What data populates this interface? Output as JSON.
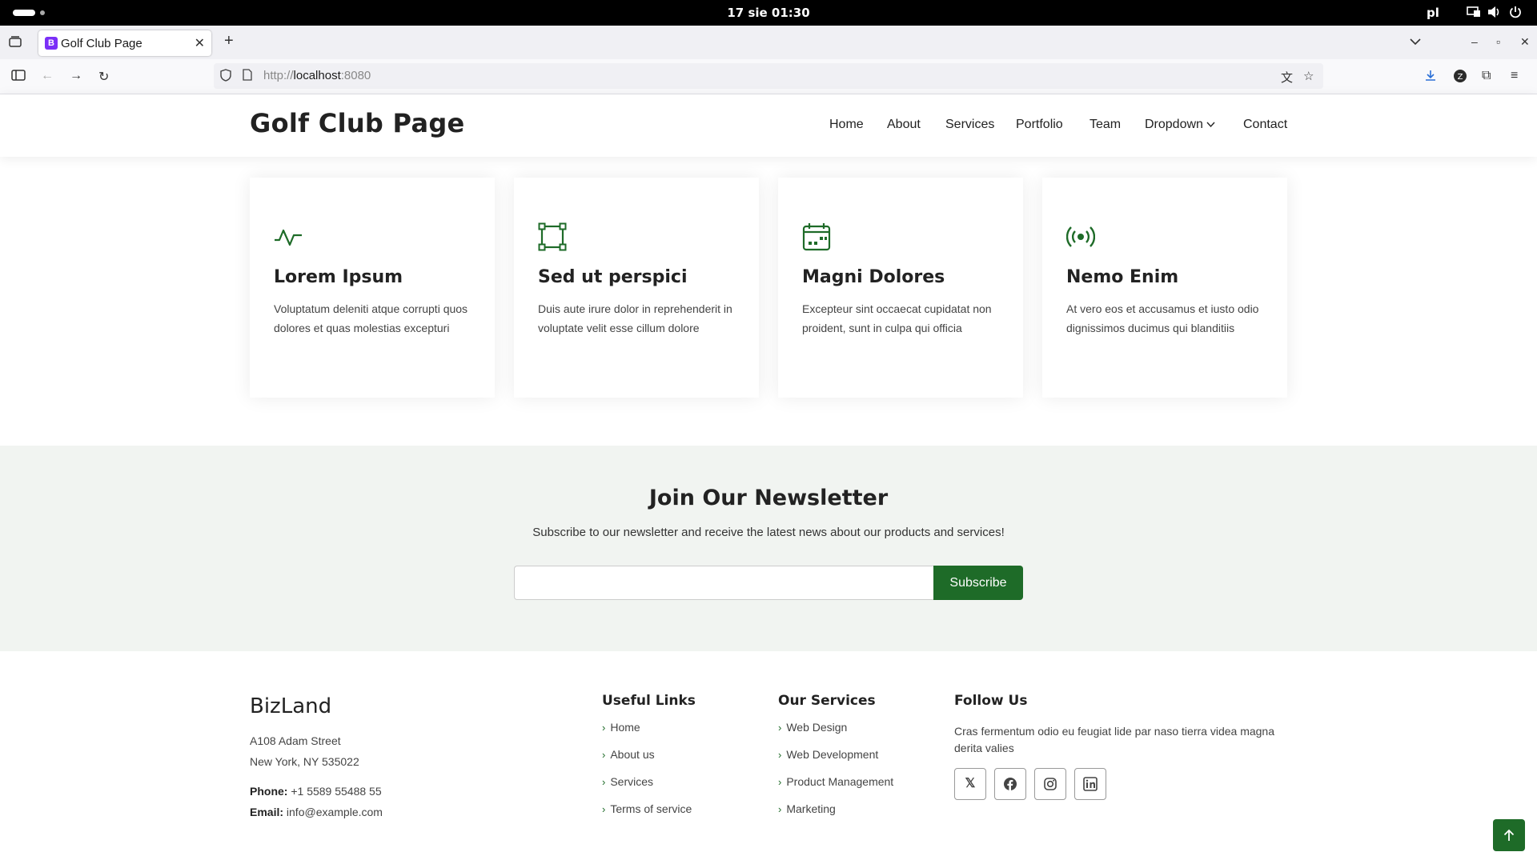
{
  "os": {
    "clock": "17 sie  01:30",
    "language": "pl",
    "tray_icons": [
      "network-icon",
      "volume-icon",
      "power-icon"
    ]
  },
  "browser": {
    "tab_title": "Golf Club Page",
    "favicon_letter": "B",
    "url_scheme": "http://",
    "url_host": "localhost",
    "url_port": ":8080"
  },
  "site": {
    "logo": "Golf Club Page",
    "menu": [
      "Home",
      "About",
      "Services",
      "Portfolio",
      "Team",
      "Dropdown",
      "Contact"
    ]
  },
  "features": [
    {
      "icon": "activity-icon",
      "title": "Lorem Ipsum",
      "text": "Voluptatum deleniti atque corrupti quos dolores et quas molestias excepturi"
    },
    {
      "icon": "bounding-box-icon",
      "title": "Sed ut perspici",
      "text": "Duis aute irure dolor in reprehenderit in voluptate velit esse cillum dolore"
    },
    {
      "icon": "calendar-icon",
      "title": "Magni Dolores",
      "text": "Excepteur sint occaecat cupidatat non proident, sunt in culpa qui officia"
    },
    {
      "icon": "broadcast-icon",
      "title": "Nemo Enim",
      "text": "At vero eos et accusamus et iusto odio dignissimos ducimus qui blanditiis"
    }
  ],
  "newsletter": {
    "title": "Join Our Newsletter",
    "subtitle": "Subscribe to our newsletter and receive the latest news about our products and services!",
    "email_value": "",
    "button": "Subscribe"
  },
  "footer": {
    "brand": "BizLand",
    "address1": "A108 Adam Street",
    "address2": "New York, NY 535022",
    "phone_label": "Phone:",
    "phone": "+1 5589 55488 55",
    "email_label": "Email:",
    "email": "info@example.com",
    "useful_links_title": "Useful Links",
    "useful_links": [
      "Home",
      "About us",
      "Services",
      "Terms of service"
    ],
    "services_title": "Our Services",
    "services": [
      "Web Design",
      "Web Development",
      "Product Management",
      "Marketing"
    ],
    "follow_title": "Follow Us",
    "follow_text": "Cras fermentum odio eu feugiat lide par naso tierra videa magna derita valies",
    "social": [
      "x-icon",
      "facebook-icon",
      "instagram-icon",
      "linkedin-icon"
    ]
  },
  "colors": {
    "accent": "#1e6b28",
    "newsletter_bg": "#f1f4f1"
  }
}
